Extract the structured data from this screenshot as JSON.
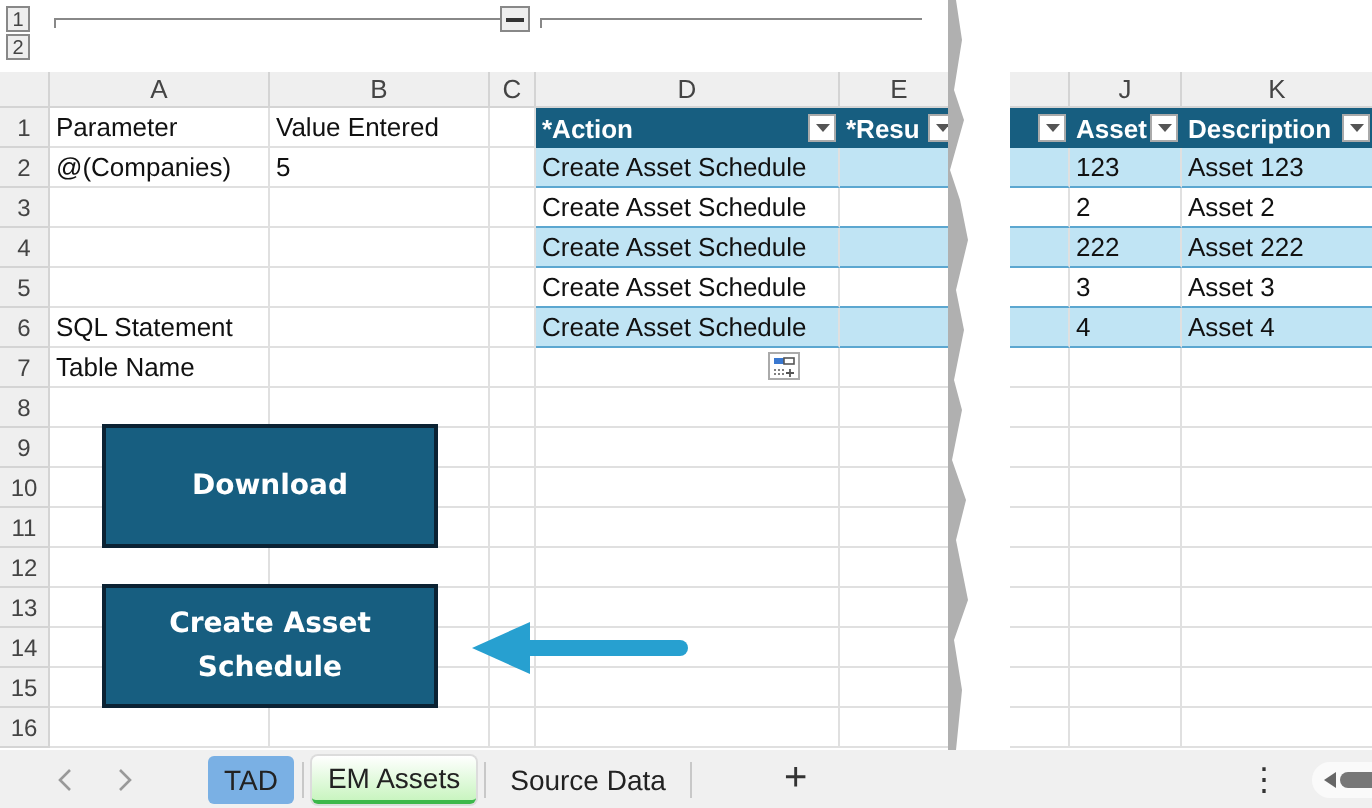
{
  "outline": {
    "levels": [
      "1",
      "2"
    ]
  },
  "left_columns": [
    "A",
    "B",
    "C",
    "D",
    "E"
  ],
  "right_columns": [
    "J",
    "K"
  ],
  "row_numbers": [
    "1",
    "2",
    "3",
    "4",
    "5",
    "6",
    "7",
    "8",
    "9",
    "10",
    "11",
    "12",
    "13",
    "14",
    "15",
    "16"
  ],
  "parameters": [
    {
      "label": "Parameter",
      "value": "Value Entered"
    },
    {
      "label": "@(Companies)",
      "value": "5"
    }
  ],
  "settings": [
    "SQL Statement",
    "Table Name"
  ],
  "table": {
    "left_headers": [
      "*Action",
      "*Resu"
    ],
    "right_headers": [
      "Asset",
      "Description"
    ],
    "rows": [
      {
        "action": "Create Asset Schedule",
        "asset": "123",
        "description": "Asset 123"
      },
      {
        "action": "Create Asset Schedule",
        "asset": "2",
        "description": "Asset 2"
      },
      {
        "action": "Create Asset Schedule",
        "asset": "222",
        "description": "Asset 222"
      },
      {
        "action": "Create Asset Schedule",
        "asset": "3",
        "description": "Asset 3"
      },
      {
        "action": "Create Asset Schedule",
        "asset": "4",
        "description": "Asset 4"
      }
    ]
  },
  "buttons": [
    "Download",
    "Create Asset Schedule"
  ],
  "sheet_tabs": [
    {
      "label": "TAD",
      "selected": false,
      "color": "#7ab0e4"
    },
    {
      "label": "EM Assets",
      "selected": true,
      "color": "#c9f5c0"
    },
    {
      "label": "Source Data",
      "selected": false
    }
  ],
  "add_sheet": "+",
  "more": "⋮"
}
